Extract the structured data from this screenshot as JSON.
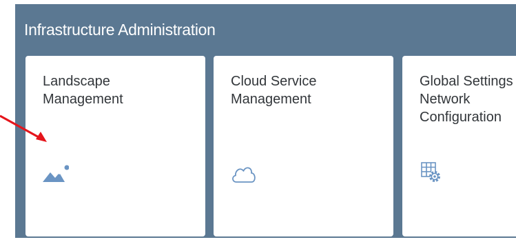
{
  "group": {
    "title": "Infrastructure Administration"
  },
  "tiles": [
    {
      "title": "Landscape\nManagement",
      "icon": "landscape-icon"
    },
    {
      "title": "Cloud Service\nManagement",
      "icon": "cloud-icon"
    },
    {
      "title": "Global Settings\nNetwork\nConfiguration",
      "icon": "grid-gear-icon"
    }
  ],
  "colors": {
    "group_background": "#5b7892",
    "tile_background": "#ffffff",
    "icon": "#6a94c3",
    "annotation_arrow": "#e5141b"
  }
}
